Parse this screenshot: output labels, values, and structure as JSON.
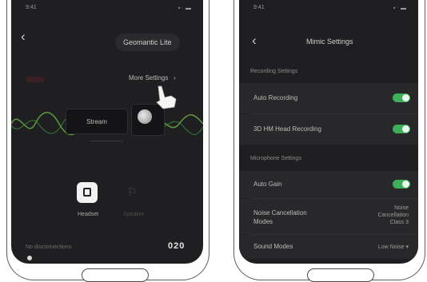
{
  "left_screen": {
    "status": {
      "time": "9:41",
      "icons": "▪ᐧ ▬"
    },
    "header": {
      "back_icon": "chevron-left-icon",
      "mode_button": "Geomantic Lite"
    },
    "more_settings": "More Settings",
    "center_card": "Stream",
    "modes": [
      {
        "label": "Headset",
        "active": true
      },
      {
        "label": "Speaker",
        "active": false
      }
    ],
    "bottom": {
      "left_text": "No disconnections",
      "code": "020"
    }
  },
  "right_screen": {
    "status": {
      "time": "9:41",
      "icons": "▪ᐧ ▬"
    },
    "title": "Mimic Settings",
    "sections": [
      {
        "title": "Recording Settings",
        "rows": [
          {
            "label": "Auto Recording",
            "toggle": true
          },
          {
            "label": "3D HM Head Recording",
            "toggle": true
          }
        ]
      },
      {
        "title": "Microphone Settings",
        "rows": [
          {
            "label": "Auto Gain",
            "toggle": true
          },
          {
            "label": "Noise Cancellation Modes",
            "value": "Noise Cancellation Class 3"
          },
          {
            "label": "Sound Modes",
            "value": "Low Noise ▾"
          }
        ]
      }
    ]
  }
}
